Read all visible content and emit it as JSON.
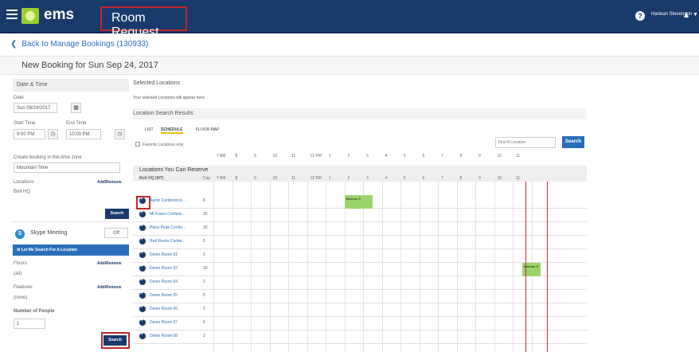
{
  "header": {
    "brand": "ems",
    "page_title": "Room Request",
    "user": "Harlean Stevenson",
    "help_icon": "help-icon",
    "user_icon": "person-icon"
  },
  "back_link": "Back to Manage Bookings (130933)",
  "new_booking": "New Booking for Sun Sep 24, 2017",
  "left": {
    "date_time_header": "Date & Time",
    "date_label": "Date",
    "date_value": "Sun 09/24/2017",
    "start_label": "Start Time",
    "start_value": "9:00 PM",
    "end_label": "End Time",
    "end_value": "10:00 PM",
    "tz_label": "Create booking in this time zone",
    "tz_value": "Mountain Time",
    "locations_label": "Locations",
    "locations_value": "Bolt HQ",
    "add_remove": "Add/Remove",
    "search_label": "Search",
    "skype_label": "Skype Meeting",
    "skype_toggle": "Off",
    "let_me_search": "Let Me Search For A Location",
    "floors_label": "Floors",
    "floors_value": "(all)",
    "features_label": "Features",
    "features_value": "(none)",
    "people_label": "Number of People",
    "people_value": "1",
    "search2_label": "Search"
  },
  "right": {
    "selected_header": "Selected Locations",
    "selected_note": "Your selected Locations will appear here.",
    "results_header": "Location Search Results",
    "tabs": [
      "LIST",
      "SCHEDULE",
      "FLOOR MAP"
    ],
    "favorites_label": "Favorite Locations only",
    "find_placeholder": "Find A Location",
    "search_btn": "Search",
    "reserve_header": "Locations You Can Reserve",
    "hq_label": "Bolt HQ (MT)",
    "cap_label": "Cap",
    "hours": [
      "7 AM",
      "8",
      "9",
      "10",
      "11",
      "12 PM",
      "1",
      "2",
      "3",
      "4",
      "5",
      "6",
      "7",
      "8",
      "9",
      "10",
      "11"
    ],
    "rows": [
      {
        "name": "Aaron Conference...",
        "cap": "8"
      },
      {
        "name": "Mt Evans Confere...",
        "cap": "20"
      },
      {
        "name": "Pikes Peak Confer...",
        "cap": "20"
      },
      {
        "name": "Red Rocks Confer...",
        "cap": "5"
      },
      {
        "name": "Demo Room 01",
        "cap": "2"
      },
      {
        "name": "Demo Room 03",
        "cap": "10"
      },
      {
        "name": "Demo Room 04",
        "cap": "2"
      },
      {
        "name": "Demo Room 05",
        "cap": "5"
      },
      {
        "name": "Demo Room 06",
        "cap": "2"
      },
      {
        "name": "Demo Room 07",
        "cap": "5"
      },
      {
        "name": "Demo Room 08",
        "cap": "2"
      }
    ],
    "bookings": [
      {
        "label": "Harlean S"
      },
      {
        "label": "Harlean S"
      }
    ]
  }
}
